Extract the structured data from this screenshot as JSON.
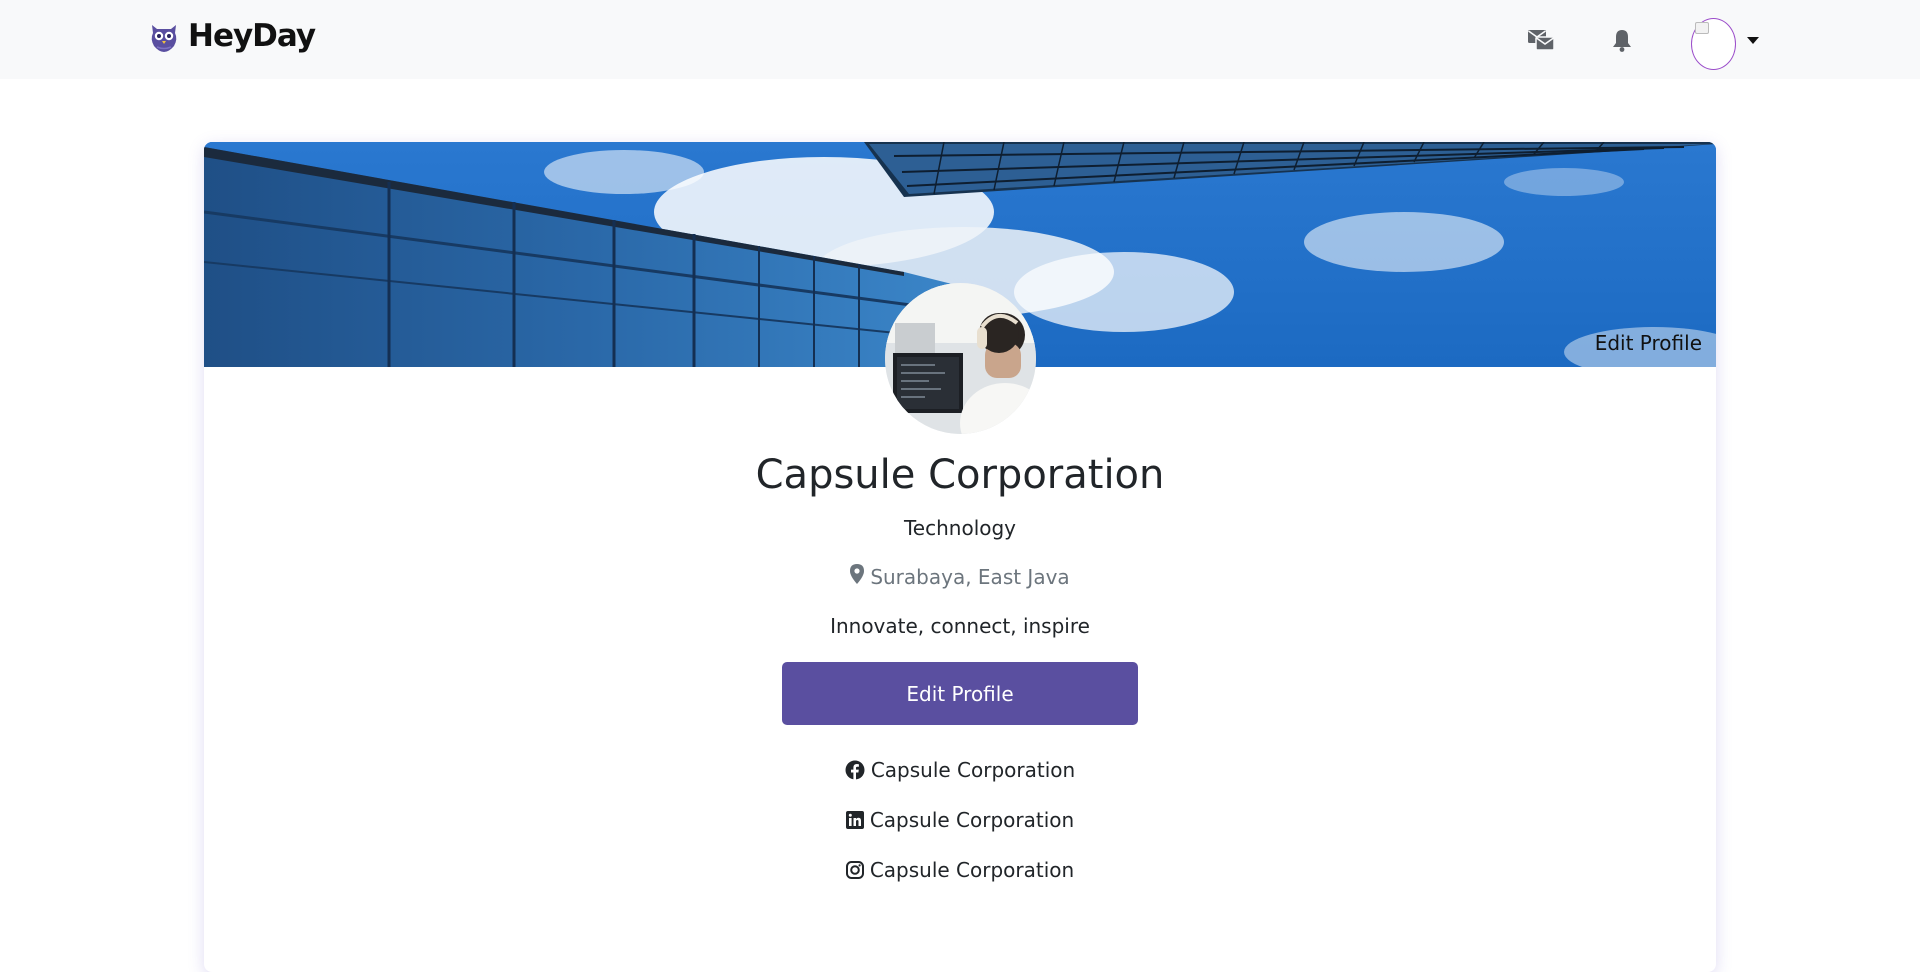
{
  "brand": {
    "name": "HeyDay",
    "logo_icon": "owl-logo-icon",
    "accent": "#5a4fa0"
  },
  "navbar": {
    "messages_icon": "mail-stack-icon",
    "notifications_icon": "bell-icon",
    "avatar_icon": "broken-image-avatar",
    "menu_icon": "caret-down-icon"
  },
  "profile": {
    "cover_edit_label": "Edit Profile",
    "name": "Capsule Corporation",
    "industry": "Technology",
    "location": "Surabaya, East Java",
    "location_icon": "map-pin-icon",
    "tagline": "Innovate, connect, inspire",
    "edit_button_label": "Edit Profile",
    "edit_button_color": "#5a4fa0",
    "socials": [
      {
        "icon": "facebook-icon",
        "label": "Capsule Corporation"
      },
      {
        "icon": "linkedin-icon",
        "label": "Capsule Corporation"
      },
      {
        "icon": "instagram-icon",
        "label": "Capsule Corporation"
      }
    ]
  }
}
